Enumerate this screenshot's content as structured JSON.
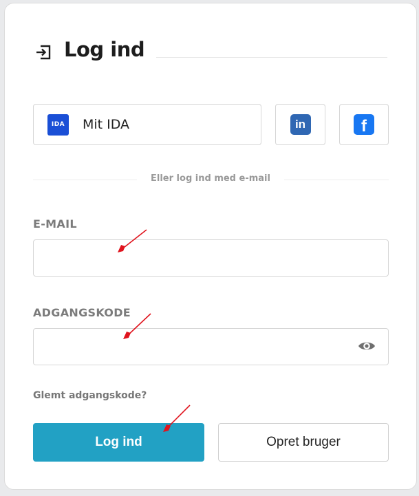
{
  "header": {
    "title": "Log ind",
    "icon": "login-icon"
  },
  "sso": {
    "ida": {
      "logo_text": "IDA",
      "label": "Mit IDA",
      "color": "#1a4fd6",
      "icon": "ida-logo-icon"
    },
    "linkedin": {
      "logo_text": "in",
      "color": "#2f67b3",
      "icon": "linkedin-icon"
    },
    "facebook": {
      "logo_text": "f",
      "color": "#1877f2",
      "icon": "facebook-icon"
    }
  },
  "divider": {
    "text": "Eller log ind med e-mail"
  },
  "form": {
    "email": {
      "label": "E-MAIL",
      "value": "",
      "placeholder": ""
    },
    "password": {
      "label": "ADGANGSKODE",
      "value": "",
      "placeholder": "",
      "toggle_icon": "eye-icon"
    },
    "forgot_link": "Glemt adgangskode?"
  },
  "actions": {
    "login_label": "Log ind",
    "create_label": "Opret bruger",
    "primary_color": "#22a1c4"
  },
  "annotations": {
    "arrow_color": "#e0141e",
    "icon": "red-arrow-icon"
  }
}
